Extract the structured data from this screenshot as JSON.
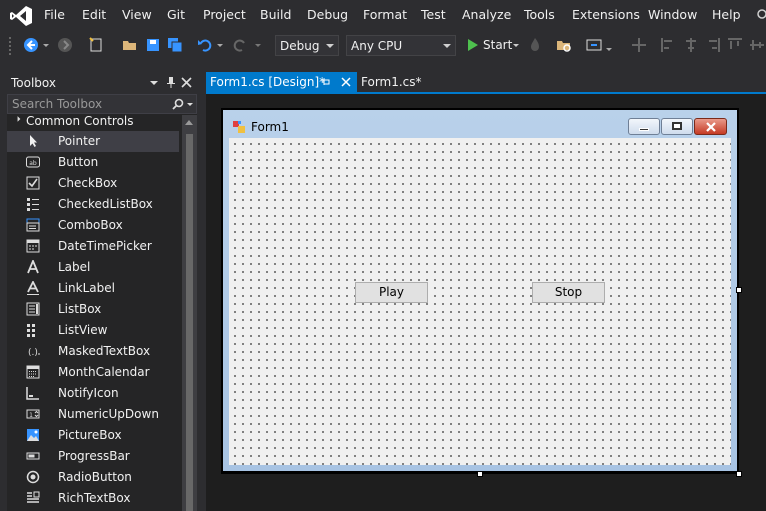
{
  "menu": {
    "items": [
      "File",
      "Edit",
      "View",
      "Git",
      "Project",
      "Build",
      "Debug",
      "Format",
      "Test",
      "Analyze",
      "Tools",
      "Extensions",
      "Window",
      "Help"
    ]
  },
  "toolbar": {
    "configuration": "Debug",
    "platform": "Any CPU",
    "start_label": "Start"
  },
  "toolbox": {
    "title": "Toolbox",
    "search_placeholder": "Search Toolbox",
    "group": "Common Controls",
    "items": [
      {
        "label": "Pointer",
        "icon": "pointer-icon"
      },
      {
        "label": "Button",
        "icon": "button-icon"
      },
      {
        "label": "CheckBox",
        "icon": "checkbox-icon"
      },
      {
        "label": "CheckedListBox",
        "icon": "checkedlistbox-icon"
      },
      {
        "label": "ComboBox",
        "icon": "combobox-icon"
      },
      {
        "label": "DateTimePicker",
        "icon": "datetimepicker-icon"
      },
      {
        "label": "Label",
        "icon": "label-icon"
      },
      {
        "label": "LinkLabel",
        "icon": "linklabel-icon"
      },
      {
        "label": "ListBox",
        "icon": "listbox-icon"
      },
      {
        "label": "ListView",
        "icon": "listview-icon"
      },
      {
        "label": "MaskedTextBox",
        "icon": "maskedtextbox-icon"
      },
      {
        "label": "MonthCalendar",
        "icon": "monthcalendar-icon"
      },
      {
        "label": "NotifyIcon",
        "icon": "notifyicon-icon"
      },
      {
        "label": "NumericUpDown",
        "icon": "numericupdown-icon"
      },
      {
        "label": "PictureBox",
        "icon": "picturebox-icon"
      },
      {
        "label": "ProgressBar",
        "icon": "progressbar-icon"
      },
      {
        "label": "RadioButton",
        "icon": "radiobutton-icon"
      },
      {
        "label": "RichTextBox",
        "icon": "richtextbox-icon"
      }
    ]
  },
  "tabs": [
    {
      "label": "Form1.cs [Design]*",
      "active": true
    },
    {
      "label": "Form1.cs*",
      "active": false
    }
  ],
  "form": {
    "title": "Form1",
    "play_label": "Play",
    "stop_label": "Stop"
  },
  "colors": {
    "accent": "#007acc",
    "background": "#2d2d30",
    "panel": "#252526",
    "start_green": "#4ec04e"
  }
}
